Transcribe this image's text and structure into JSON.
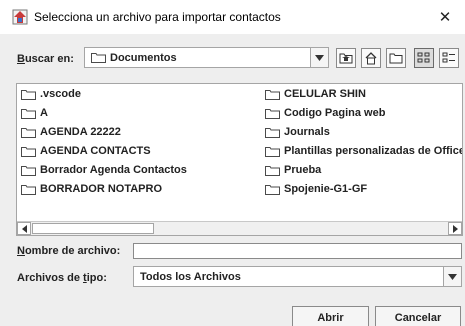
{
  "window": {
    "title": "Selecciona un archivo para importar contactos",
    "close_glyph": "✕"
  },
  "lookin": {
    "label_prefix": "B",
    "label_rest": "uscar en:",
    "value": "Documentos",
    "toolbar_icons": [
      "up-one-level-icon",
      "home-icon",
      "new-folder-icon",
      "list-view-icon",
      "details-view-icon"
    ]
  },
  "files": {
    "left_column": [
      ".vscode",
      "A",
      "AGENDA 22222",
      "AGENDA CONTACTS",
      "Borrador Agenda Contactos",
      "BORRADOR NOTAPRO"
    ],
    "right_column": [
      "CELULAR SHIN",
      "Codigo Pagina web",
      "Journals",
      "Plantillas personalizadas de Office",
      "Prueba",
      "Spojenie-G1-GF"
    ]
  },
  "filename": {
    "label_prefix": "N",
    "label_rest": "ombre de archivo:",
    "value": ""
  },
  "filetype": {
    "label_start": "Archivos de ",
    "label_u": "t",
    "label_end": "ipo:",
    "value": "Todos los Archivos"
  },
  "buttons": {
    "open": "Abrir",
    "cancel": "Cancelar"
  },
  "colors": {
    "window_bg": "#eeeeee",
    "folder_outline": "#4a4a4a"
  }
}
